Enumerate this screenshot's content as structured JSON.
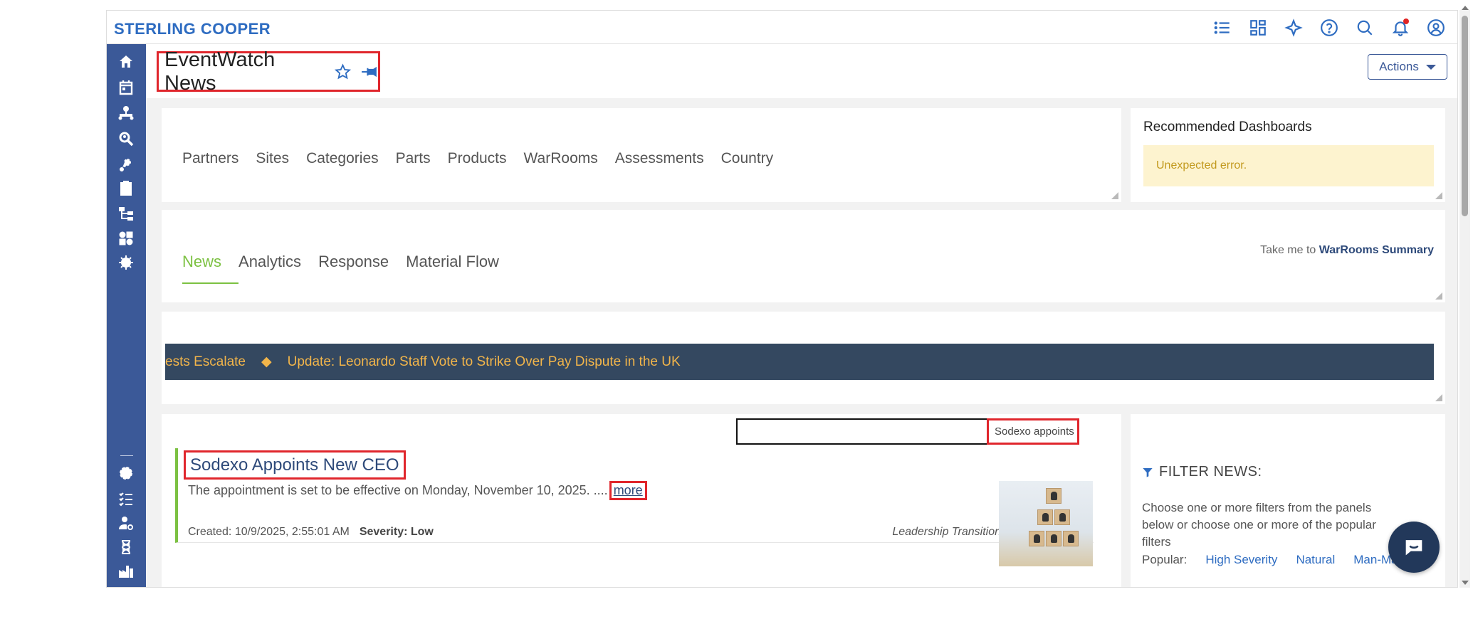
{
  "brand": "STERLING COOPER",
  "page": {
    "title": "EventWatch News",
    "actions_label": "Actions"
  },
  "categories": [
    "Partners",
    "Sites",
    "Categories",
    "Parts",
    "Products",
    "WarRooms",
    "Assessments",
    "Country"
  ],
  "recommended": {
    "title": "Recommended Dashboards",
    "error": "Unexpected error."
  },
  "tabs": [
    "News",
    "Analytics",
    "Response",
    "Material Flow"
  ],
  "takeme": {
    "prefix": "Take me to ",
    "link": "WarRooms Summary"
  },
  "ticker": {
    "items": [
      "ests Escalate",
      "◆",
      "Update: Leonardo Staff Vote to Strike Over Pay Dispute in the UK"
    ]
  },
  "search": {
    "value": "Sodexo appoints"
  },
  "news": {
    "title": "Sodexo Appoints New CEO",
    "description": "The appointment is set to be effective on Monday, November 10, 2025. ....",
    "more": "more",
    "created": "Created: 10/9/2025, 2:55:01 AM",
    "severity": "Severity: Low",
    "tag": "Leadership Transition"
  },
  "filter": {
    "title": "FILTER  NEWS:",
    "description": "Choose one or more filters from the panels below or choose one or more of the popular filters",
    "popular_label": "Popular:",
    "popular": [
      "High Severity",
      "Natural",
      "Man-Ma"
    ]
  },
  "colors": {
    "brand": "#2e6cc1",
    "sidebar": "#3b5998",
    "active_tab": "#7cc142",
    "highlight": "#e0262c",
    "ticker_bg": "#344860",
    "ticker_text": "#f2b54a"
  },
  "icons": {
    "topbar": [
      "list-icon",
      "dashboard-grid-icon",
      "sparkle-ai-icon",
      "help-icon",
      "search-icon",
      "bell-icon",
      "user-icon"
    ],
    "sidebar": [
      "home-icon",
      "calendar-icon",
      "org-chart-icon",
      "search-person-icon",
      "route-icon",
      "clipboard-icon",
      "hierarchy-icon",
      "modules-icon",
      "gear-dollar-icon",
      "settings-icon",
      "checklist-icon",
      "user-settings-icon",
      "hourglass-icon",
      "factory-icon"
    ]
  }
}
